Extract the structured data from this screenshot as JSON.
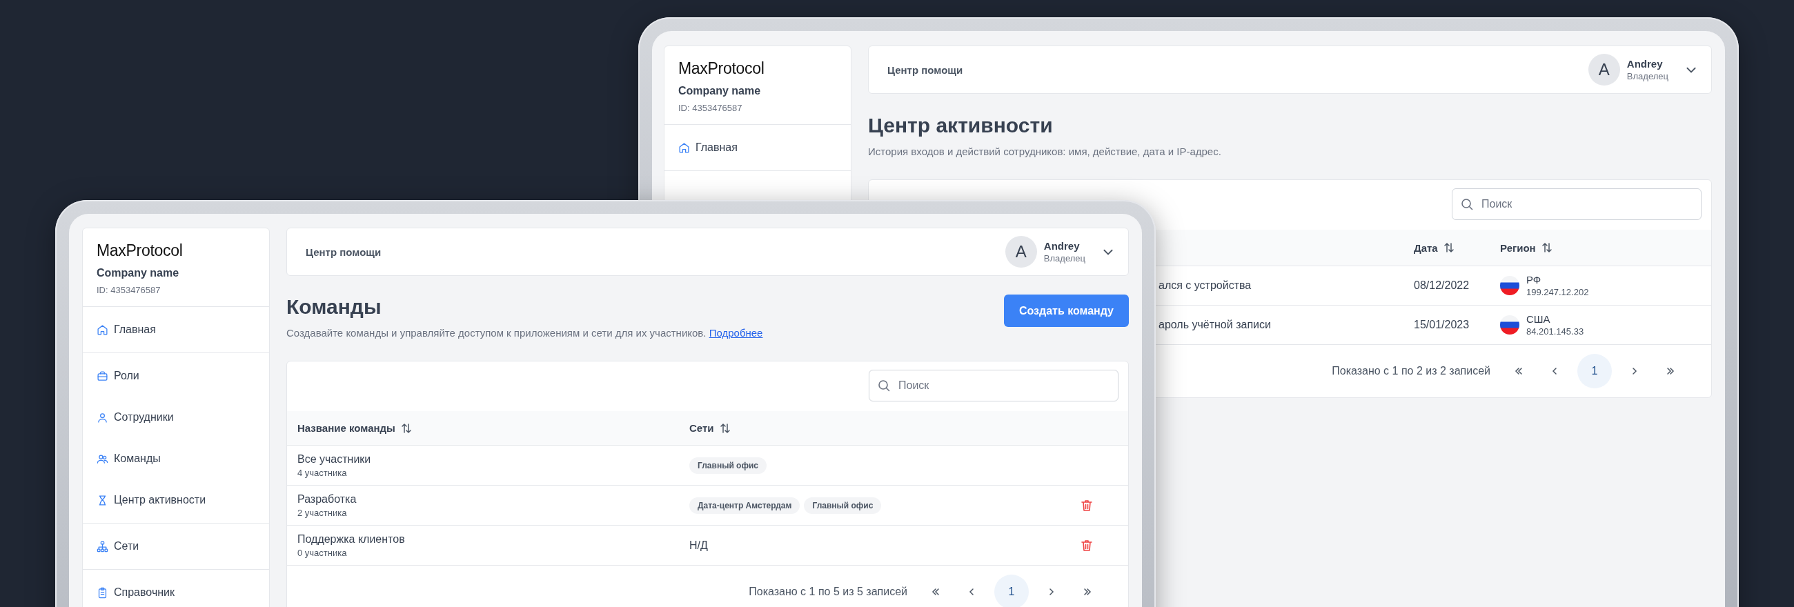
{
  "back_window": {
    "sidebar": {
      "logo": "MaxProtocol",
      "company": "Company name",
      "company_id": "ID: 4353476587",
      "nav_groups": [
        [
          {
            "label": "Главная",
            "kind": "home"
          }
        ]
      ]
    },
    "header": {
      "help": "Центр помощи",
      "avatar": "A",
      "user": "Andrey",
      "role": "Владелец"
    },
    "title": "Центр активности",
    "description": "История входов и действий сотрудников: имя, действие, дата и IP-адрес.",
    "search": {
      "placeholder": "Поиск"
    },
    "columns": [
      {
        "label": "Дата"
      },
      {
        "label": "Регион"
      }
    ],
    "rows": [
      {
        "column_1": "ался с устройства",
        "date": "08/12/2022",
        "region": "РФ",
        "ip": "199.247.12.202"
      },
      {
        "column_1": "ароль учётной записи",
        "date": "15/01/2023",
        "region": "США",
        "ip": "84.201.145.33"
      }
    ],
    "pagination": {
      "summary": "Показано с 1 по 2 из 2 записей",
      "pages": [
        {
          "label": "1",
          "selected": true
        }
      ]
    }
  },
  "front_window": {
    "sidebar": {
      "logo": "MaxProtocol",
      "company": "Company name",
      "company_id": "ID: 4353476587",
      "nav_groups": [
        [
          {
            "label": "Главная",
            "kind": "home"
          }
        ],
        [
          {
            "label": "Роли",
            "kind": "briefcase"
          },
          {
            "label": "Сотрудники",
            "kind": "user"
          },
          {
            "label": "Команды",
            "kind": "users"
          },
          {
            "label": "Центр активности",
            "kind": "hourglass"
          }
        ],
        [
          {
            "label": "Сети",
            "kind": "network"
          }
        ],
        [
          {
            "label": "Справочник",
            "kind": "clipboard"
          }
        ]
      ]
    },
    "header": {
      "help": "Центр помощи",
      "avatar": "A",
      "user": "Andrey",
      "role": "Владелец"
    },
    "title": "Команды",
    "action_button": "Создать команду",
    "description": "Создавайте команды и управляйте доступом к приложениям и сети для их участников.",
    "link": "Подробнее",
    "search": {
      "placeholder": "Поиск"
    },
    "columns": [
      {
        "label": "Название команды"
      },
      {
        "label": "Сети"
      }
    ],
    "rows": [
      {
        "name": "Все участники",
        "members": "4 участника",
        "networks": [
          "Главный офис"
        ],
        "deletable": false
      },
      {
        "name": "Разработка",
        "members": "2 участника",
        "networks": [
          "Дата-центр Амстердам",
          "Главный офис"
        ],
        "deletable": true
      },
      {
        "name": "Поддержка клиентов",
        "members": "0 участника",
        "networks_note": "Н/Д",
        "deletable": true
      }
    ],
    "pagination": {
      "summary": "Показано с 1 по 5 из 5 записей",
      "pages": [
        {
          "label": "1",
          "selected": true
        }
      ]
    }
  }
}
